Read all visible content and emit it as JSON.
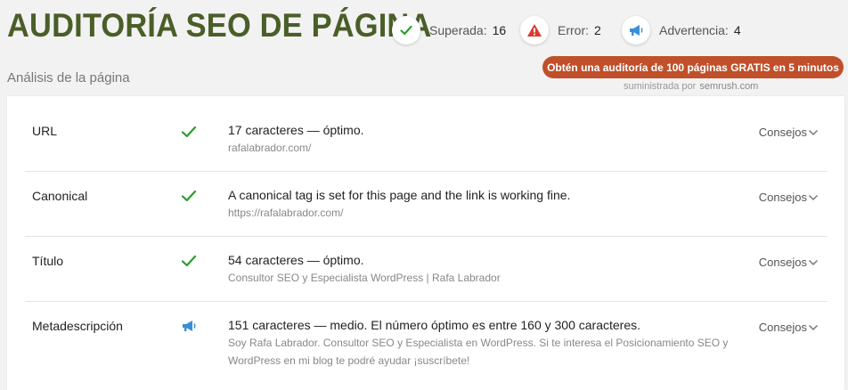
{
  "header": {
    "title": "AUDITORÍA SEO DE PÁGINA",
    "subtitle": "Análisis de la página"
  },
  "stats": [
    {
      "label": "Superada:",
      "value": "16",
      "icon": "check-icon",
      "color": "#2a9d2a"
    },
    {
      "label": "Error:",
      "value": "2",
      "icon": "warning-icon",
      "color": "#d93a2b"
    },
    {
      "label": "Advertencia:",
      "value": "4",
      "icon": "megaphone-icon",
      "color": "#3a8fd8"
    }
  ],
  "promo": {
    "button_label": "Obtén una auditoría de 100 páginas GRATIS en 5 minutos",
    "powered_text": "suministrada por",
    "powered_brand": "semrush.com",
    "color": "#c0502a"
  },
  "rows": [
    {
      "label": "URL",
      "status": "pass",
      "icon": "check-icon",
      "message": "17 caracteres — óptimo.",
      "detail": "rafalabrador.com/",
      "tips_label": "Consejos"
    },
    {
      "label": "Canonical",
      "status": "pass",
      "icon": "check-icon",
      "message": "A canonical tag is set for this page and the link is working fine.",
      "detail": "https://rafalabrador.com/",
      "tips_label": "Consejos"
    },
    {
      "label": "Título",
      "status": "pass",
      "icon": "check-icon",
      "message": "54 caracteres — óptimo.",
      "detail": "Consultor SEO y Especialista WordPress | Rafa Labrador",
      "tips_label": "Consejos"
    },
    {
      "label": "Metadescripción",
      "status": "warning",
      "icon": "megaphone-icon",
      "message": "151 caracteres — medio. El número óptimo es entre 160 y 300 caracteres.",
      "detail": "Soy Rafa Labrador. Consultor SEO y Especialista en WordPress. Si te interesa el Posicionamiento SEO y WordPress en mi blog te podré ayudar ¡suscríbete!",
      "tips_label": "Consejos"
    }
  ]
}
